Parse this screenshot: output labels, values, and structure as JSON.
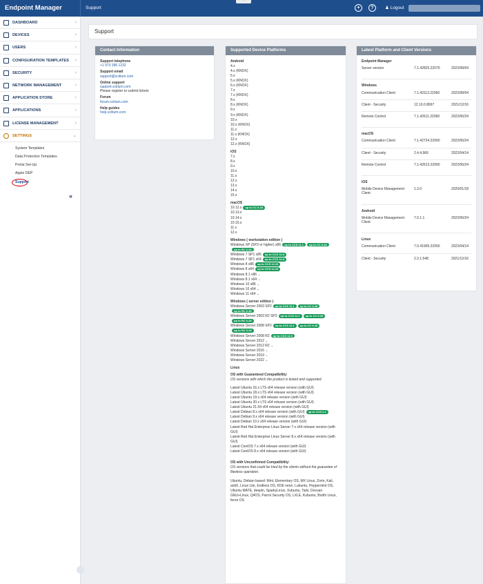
{
  "app": {
    "title": "Endpoint Manager",
    "breadcrumb": "Support",
    "collapse_glyph": "⌃"
  },
  "topbar": {
    "icons": [
      {
        "name": "add-icon",
        "glyph": "+"
      },
      {
        "name": "help-icon",
        "glyph": "?"
      },
      {
        "name": "user-icon",
        "glyph": "♟"
      }
    ],
    "logout": "Logout"
  },
  "sidebar": {
    "items": [
      {
        "name": "dashboard",
        "label": "DASHBOARD",
        "icon": "grid-icon"
      },
      {
        "name": "devices",
        "label": "DEVICES",
        "icon": "monitor-icon"
      },
      {
        "name": "users",
        "label": "USERS",
        "icon": "user-icon"
      },
      {
        "name": "configuration-templates",
        "label": "CONFIGURATION TEMPLATES",
        "icon": "template-icon"
      },
      {
        "name": "security",
        "label": "SECURITY",
        "icon": "shield-icon"
      },
      {
        "name": "network-management",
        "label": "NETWORK MANAGEMENT",
        "icon": "network-icon"
      },
      {
        "name": "application-store",
        "label": "APPLICATION STORE",
        "icon": "cart-icon"
      },
      {
        "name": "applications",
        "label": "APPLICATIONS",
        "icon": "apps-icon"
      },
      {
        "name": "license-management",
        "label": "LICENSE MANAGEMENT",
        "icon": "license-icon"
      },
      {
        "name": "settings",
        "label": "SETTINGS",
        "icon": "gear-icon"
      }
    ],
    "settings_sub": [
      "System Templates",
      "Data Protection Templates",
      "Portal Set-Up",
      "Apple DEP",
      "Support"
    ],
    "collapse": "«"
  },
  "page": {
    "title": "Support"
  },
  "contact": {
    "header": "Contact Information",
    "telephone_label": "Support telephone",
    "telephone": "+1 973 396 1232",
    "email_label": "Support email",
    "email": "support@xcitium.com",
    "online_label": "Online support",
    "online_link": "support.xcitium.com",
    "online_note": "Please register to submit tickets",
    "forum_label": "Forum",
    "forum_link": "forum.xcitium.com",
    "guides_label": "Help guides",
    "guides_link": "help.xcitium.com"
  },
  "platforms": {
    "header": "Supported Device Platforms",
    "android_title": "Android",
    "android": [
      "4.x",
      "4.x (KNOX)",
      "5.x",
      "5.x (KNOX)",
      "6.x (KNOX)",
      "7.x",
      "7.x (KNOX)",
      "8.x",
      "8.x (KNOX)",
      "9.x",
      "9.x (KNOX)",
      "10.x",
      "10.x (KNOX)",
      "11.x",
      "11.x (KNOX)",
      "12.x",
      "12.x (KNOX)"
    ],
    "ios_title": "iOS",
    "ios": [
      "7.x",
      "8.x",
      "9.x",
      "10.x",
      "11.x",
      "12.x",
      "13.x",
      "14.x",
      "15.x"
    ],
    "macos_title": "macOS",
    "macos": [
      {
        "t": "10.12.x",
        "b": [
          "up to CC 6.43"
        ]
      },
      {
        "t": "10.13.x"
      },
      {
        "t": "10.14.x"
      },
      {
        "t": "10.15.x"
      },
      {
        "t": "11.x"
      },
      {
        "t": "12.x"
      }
    ],
    "win_ws_title": "Windows ( workstation edition )",
    "win_ws": [
      {
        "t": "Windows XP (SP3 or higher) x86",
        "b": [
          "up to CCS 11.1",
          "up to CC 6.28",
          "up to RC 6.28"
        ]
      },
      {
        "t": "Windows 7 SP1 x86",
        "b": [
          "up to CCS 12.8"
        ]
      },
      {
        "t": "Windows 7 SP1 x64",
        "b": [
          "up to CCS 12.8"
        ]
      },
      {
        "t": "Windows 8 x86",
        "b": [
          "up to CCS 12.10"
        ]
      },
      {
        "t": "Windows 8 x64",
        "b": [
          "up to CCS 12.10"
        ]
      },
      {
        "t": "Windows 8.1 x86",
        "dd": true
      },
      {
        "t": "Windows 8.1 x64",
        "dd": true
      },
      {
        "t": "Windows 10 x86",
        "dd": true
      },
      {
        "t": "Windows 10 x64",
        "dd": true
      },
      {
        "t": "Windows 11 x64",
        "dd": true
      }
    ],
    "win_srv_title": "Windows ( server edition )",
    "win_srv": [
      {
        "t": "Windows Server 2003 SP2",
        "b": [
          "up to CCS 11.1",
          "up to CC 6.28",
          "up to RC 6.28"
        ]
      },
      {
        "t": "Windows Server 2003 R2 SP2",
        "b": [
          "up to CCS 11.1",
          "up to CC 6.28",
          "up to RC 6.28"
        ]
      },
      {
        "t": "Windows Server 2008 SP2",
        "b": [
          "up to CCS 11.1",
          "up to CC 6.28",
          "up to RC 6.28"
        ]
      },
      {
        "t": "Windows Server 2008 R2",
        "b": [
          "up to CCS 12.0"
        ]
      },
      {
        "t": "Windows Server 2012",
        "dd": true
      },
      {
        "t": "Windows Server 2012 R2",
        "dd": true
      },
      {
        "t": "Windows Server 2016",
        "dd": true
      },
      {
        "t": "Windows Server 2019",
        "dd": true
      },
      {
        "t": "Windows Server 2022",
        "dd": true
      }
    ],
    "linux_title": "Linux",
    "linux_guar_title": "OS with Guaranteed Compatibility:",
    "linux_guar_note": "OS versions with which the product is tested and supported.",
    "linux_guar": [
      {
        "t": "Latest Ubuntu 16.x LTS x64 release version (with GUI)"
      },
      {
        "t": "Latest Ubuntu 18.x LTS x64 release version (with GUI)"
      },
      {
        "t": "Latest Ubuntu 19.x x64 release version (with GUI)"
      },
      {
        "t": "Latest Ubuntu 20.x LTS x64 release version (with GUI)"
      },
      {
        "t": "Latest Ubuntu 21.04 x64 release version (with GUI)"
      },
      {
        "t": "Latest Debian 8.x x64 release version (with GUI)",
        "b": [
          "up to CCS 2.2"
        ]
      },
      {
        "t": "Latest Debian 9.x x64 release version (with GUI)"
      },
      {
        "t": "Latest Debian 10.x x64 release version (with GUI)"
      },
      {
        "t": "Latest Red Hat Enterprise Linux Server 7.x x64 release version (with GUI)"
      },
      {
        "t": "Latest Red Hat Enterprise Linux Server 8.x x64 release version (with GUI)"
      },
      {
        "t": "Latest CentOS 7.x x64 release version (with GUI)"
      },
      {
        "t": "Latest CentOS 8.x x64 release version (with GUI)"
      }
    ],
    "linux_unconf_title": "OS with Unconfirmed Compatibility:",
    "linux_unconf_note": "OS versions that could be tried by the clients without the guarantee of flawless operation.",
    "linux_unconf": "Ubuntu, Debian based: Mint, Elementary OS, MX Linux, Zorin, Kali, antiX, Linux Lite, Endless OS, KDE neon, Lubuntu, Peppermint OS, Ubuntu MATE, deepin, SparkyLinux, Xubuntu, Tails, Devuan GNU+Linux, Q4OS, Parrot Security OS, LXLE, Kubuntu, Bodhi Linux, feren OS"
  },
  "versions": {
    "header": "Latest Platform and Client Versions",
    "groups": [
      {
        "title": "Endpoint Manager",
        "rows": [
          [
            "Server version",
            "7.1.42825.22070",
            "2022/08/04"
          ]
        ]
      },
      {
        "title": "Windows",
        "rows": [
          [
            "Communication Client",
            "7.1.43113.22060",
            "2022/08/04"
          ],
          [
            "Client - Security",
            "12.10.0.8697",
            "2021/12/16"
          ],
          [
            "Remote Control",
            "7.1.42611.22060",
            "2022/06/24"
          ]
        ]
      },
      {
        "title": "macOS",
        "rows": [
          [
            "Communication Client",
            "7.1.42724.22060",
            "2022/06/24"
          ],
          [
            "Client - Security",
            "2.4.4.966",
            "2022/04/14"
          ],
          [
            "Remote Control",
            "7.1.42613.22060",
            "2022/06/24"
          ]
        ]
      },
      {
        "title": "iOS",
        "rows": [
          [
            "Mobile Device Management Client",
            "1.3.0",
            "2020/01/18"
          ]
        ]
      },
      {
        "title": "Android",
        "rows": [
          [
            "Mobile Device Management Client",
            "7.0.1.1",
            "2022/06/24"
          ]
        ]
      },
      {
        "title": "Linux",
        "rows": [
          [
            "Communication Client",
            "7.0.41995.22050",
            "2022/04/14"
          ],
          [
            "Client - Security",
            "2.3.1.548",
            "2021/12/16"
          ]
        ]
      }
    ]
  }
}
